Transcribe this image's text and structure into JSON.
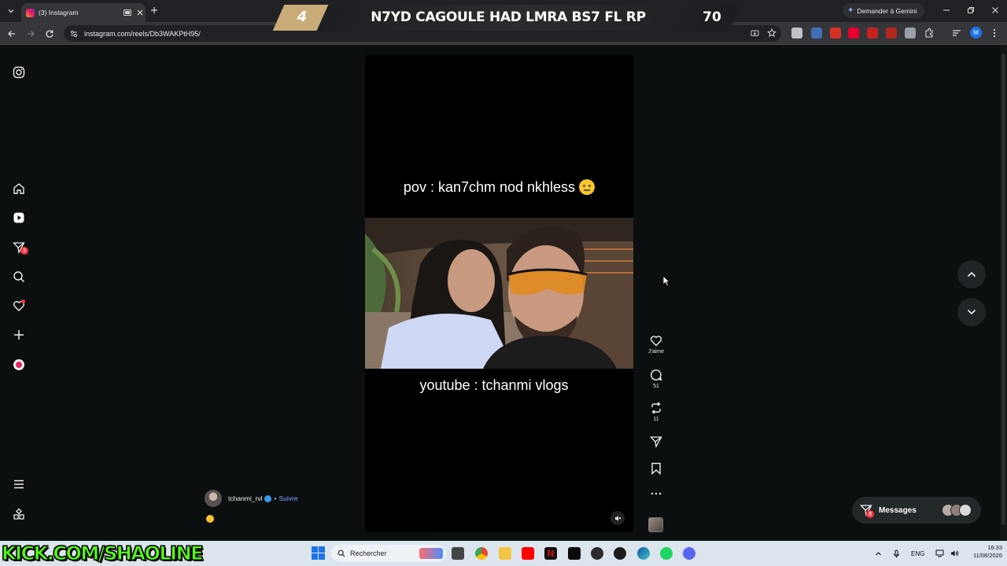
{
  "browser": {
    "tab": {
      "title": "(3) Instagram"
    },
    "url": "instagram.com/reels/Db3WAKPtH95/",
    "gemini_label": "Demander à Gemini",
    "profile_initial": "M"
  },
  "stream_overlay": {
    "rank": "4",
    "title": "N7YD CAGOULE HAD LMRA BS7 FL RP",
    "score": "70",
    "kick_url": "KICK.COM/SHAOLINE"
  },
  "instagram": {
    "sidebar": {
      "notifications_badge": "3"
    },
    "reel": {
      "caption_top": "pov : kan7chm nod nkhless",
      "caption_bottom": "youtube : tchanmi vlogs"
    },
    "actions": {
      "like_label": "J'aime",
      "comments_count": "51",
      "reposts_count": "11"
    },
    "author": {
      "username": "tchanmi_rvl",
      "separator": "•",
      "follow_label": "Suivre"
    },
    "messages": {
      "label": "Messages",
      "badge": "3"
    }
  },
  "taskbar": {
    "search_placeholder": "Rechercher",
    "language": "ENG",
    "time": "16:33",
    "date": "11/08/2026"
  },
  "colors": {
    "accent_kick": "#53fc18",
    "instagram_badge": "#ff3040",
    "banner_gold": "#c9ab77"
  }
}
